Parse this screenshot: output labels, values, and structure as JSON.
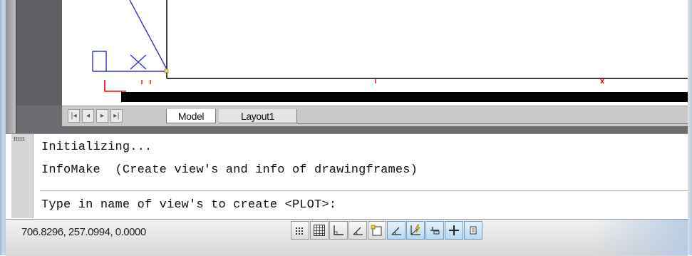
{
  "layout_tabs": {
    "nav_first": "|◂",
    "nav_prev": "◂",
    "nav_next": "▸",
    "nav_last": "▸|",
    "tabs": [
      {
        "label": "Model",
        "active": true
      },
      {
        "label": "Layout1",
        "active": false
      }
    ]
  },
  "command_window": {
    "history": [
      "Initializing...",
      "InfoMake  (Create view's and info of drawingframes)"
    ],
    "prompt": "Type in name of view's to create <PLOT>:"
  },
  "status_bar": {
    "coordinates": "706.8296, 257.0994, 0.0000",
    "toggles": [
      {
        "name": "snap-icon",
        "on": false
      },
      {
        "name": "grid-icon",
        "on": false
      },
      {
        "name": "ortho-icon",
        "on": false
      },
      {
        "name": "polar-icon",
        "on": false
      },
      {
        "name": "osnap-icon",
        "on": false
      },
      {
        "name": "otrack-icon",
        "on": true
      },
      {
        "name": "ducs-icon",
        "on": true
      },
      {
        "name": "dyn-icon",
        "on": true
      },
      {
        "name": "lineweight-icon",
        "on": true
      },
      {
        "name": "model-icon",
        "on": true
      }
    ]
  },
  "colors": {
    "model_space_bg": "#6b6d70",
    "geometry_blue": "#3333cc",
    "geometry_red": "#ff0000",
    "toggle_on": "#b9d8ee"
  }
}
